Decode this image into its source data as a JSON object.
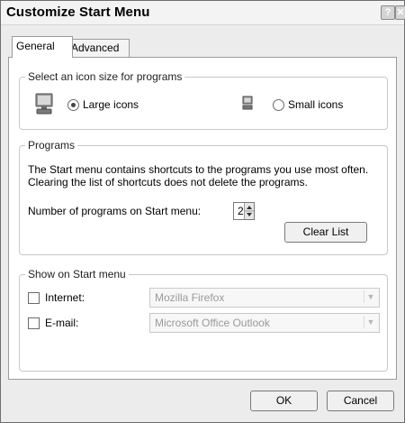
{
  "window": {
    "title": "Customize Start Menu",
    "help_label": "?",
    "close_label": "✕"
  },
  "tabs": [
    {
      "label": "General",
      "selected": true
    },
    {
      "label": "Advanced",
      "selected": false
    }
  ],
  "icon_size": {
    "legend": "Select an icon size for programs",
    "large_label": "Large icons",
    "small_label": "Small icons",
    "selected": "Large icons",
    "large_icon": "computer-large-icon",
    "small_icon": "computer-small-icon"
  },
  "programs": {
    "legend": "Programs",
    "description_line1": "The Start menu contains shortcuts to the programs you use most often.",
    "description_line2": "Clearing the list of shortcuts does not delete the programs.",
    "count_label": "Number of programs on Start menu:",
    "count_value": "2",
    "clear_button": "Clear List"
  },
  "show_on_start": {
    "legend": "Show on Start menu",
    "internet_label": "Internet:",
    "internet_checked": false,
    "internet_value": "Mozilla Firefox",
    "email_label": "E-mail:",
    "email_checked": false,
    "email_value": "Microsoft Office Outlook"
  },
  "footer": {
    "ok_label": "OK",
    "cancel_label": "Cancel"
  }
}
